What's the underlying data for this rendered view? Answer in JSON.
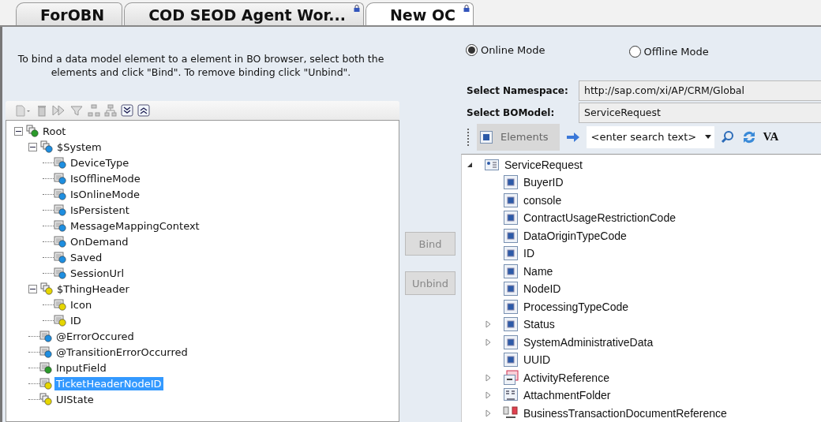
{
  "tabs": [
    {
      "label": "ForOBN",
      "selected": false,
      "locked": false
    },
    {
      "label": "COD SEOD Agent Wor...",
      "selected": false,
      "locked": true
    },
    {
      "label": "New OC",
      "selected": true,
      "locked": true
    }
  ],
  "instructions": "To bind a data model element to a element in BO browser, select both the elements and click \"Bind\". To remove binding click \"Unbind\".",
  "data_model_tree": [
    {
      "label": "Root",
      "kind": "group",
      "color": "#2a9a2a",
      "selected": false,
      "expanded": true,
      "children": [
        {
          "label": "$System",
          "kind": "group",
          "color": "#1e8ee0",
          "selected": false,
          "expanded": true,
          "children": [
            {
              "label": "DeviceType",
              "kind": "field",
              "color": "#1e8ee0",
              "selected": false
            },
            {
              "label": "IsOfflineMode",
              "kind": "field",
              "color": "#1e8ee0",
              "selected": false
            },
            {
              "label": "IsOnlineMode",
              "kind": "field",
              "color": "#1e8ee0",
              "selected": false
            },
            {
              "label": "IsPersistent",
              "kind": "field",
              "color": "#1e8ee0",
              "selected": false
            },
            {
              "label": "MessageMappingContext",
              "kind": "field",
              "color": "#1e8ee0",
              "selected": false
            },
            {
              "label": "OnDemand",
              "kind": "field",
              "color": "#1e8ee0",
              "selected": false
            },
            {
              "label": "Saved",
              "kind": "field",
              "color": "#1e8ee0",
              "selected": false
            },
            {
              "label": "SessionUrl",
              "kind": "field",
              "color": "#1e8ee0",
              "selected": false
            }
          ]
        },
        {
          "label": "$ThingHeader",
          "kind": "group",
          "color": "#e6d600",
          "selected": false,
          "expanded": true,
          "children": [
            {
              "label": "Icon",
              "kind": "field",
              "color": "#e6d600",
              "selected": false
            },
            {
              "label": "ID",
              "kind": "field",
              "color": "#e6d600",
              "selected": false
            }
          ]
        },
        {
          "label": "@ErrorOccured",
          "kind": "field",
          "color": "#1e8ee0",
          "selected": false
        },
        {
          "label": "@TransitionErrorOccurred",
          "kind": "field",
          "color": "#1e8ee0",
          "selected": false
        },
        {
          "label": "InputField",
          "kind": "field",
          "color": "#2a9a2a",
          "selected": false
        },
        {
          "label": "TicketHeaderNodeID",
          "kind": "field",
          "color": "#e6d600",
          "selected": true
        },
        {
          "label": "UIState",
          "kind": "group",
          "color": "#e6d600",
          "selected": false
        }
      ]
    }
  ],
  "buttons": [
    {
      "label": "Bind",
      "disabled": true
    },
    {
      "label": "Unbind",
      "disabled": true
    }
  ],
  "modes": [
    {
      "label": "Online Mode",
      "selected": true
    },
    {
      "label": "Offline Mode",
      "selected": false
    }
  ],
  "namespace": {
    "label": "Select Namespace:",
    "value": "http://sap.com/xi/AP/CRM/Global"
  },
  "bo_model": {
    "label": "Select BOModel:",
    "value": "ServiceRequest"
  },
  "bo_toolbar": {
    "filter": "Elements",
    "search_placeholder": "<enter search text>",
    "va": "VA"
  },
  "bo_tree": [
    {
      "label": "ServiceRequest",
      "kind": "root",
      "expanded": true,
      "children": [
        {
          "label": "BuyerID",
          "kind": "element"
        },
        {
          "label": "console",
          "kind": "element"
        },
        {
          "label": "ContractUsageRestrictionCode",
          "kind": "element"
        },
        {
          "label": "DataOriginTypeCode",
          "kind": "element"
        },
        {
          "label": "ID",
          "kind": "element"
        },
        {
          "label": "Name",
          "kind": "element"
        },
        {
          "label": "NodeID",
          "kind": "element"
        },
        {
          "label": "ProcessingTypeCode",
          "kind": "element"
        },
        {
          "label": "Status",
          "kind": "element",
          "expanded": false
        },
        {
          "label": "SystemAdministrativeData",
          "kind": "element",
          "expanded": false
        },
        {
          "label": "UUID",
          "kind": "element"
        },
        {
          "label": "ActivityReference",
          "kind": "association",
          "expanded": false
        },
        {
          "label": "AttachmentFolder",
          "kind": "folder",
          "expanded": false
        },
        {
          "label": "BusinessTransactionDocumentReference",
          "kind": "docref",
          "expanded": false
        }
      ]
    }
  ]
}
